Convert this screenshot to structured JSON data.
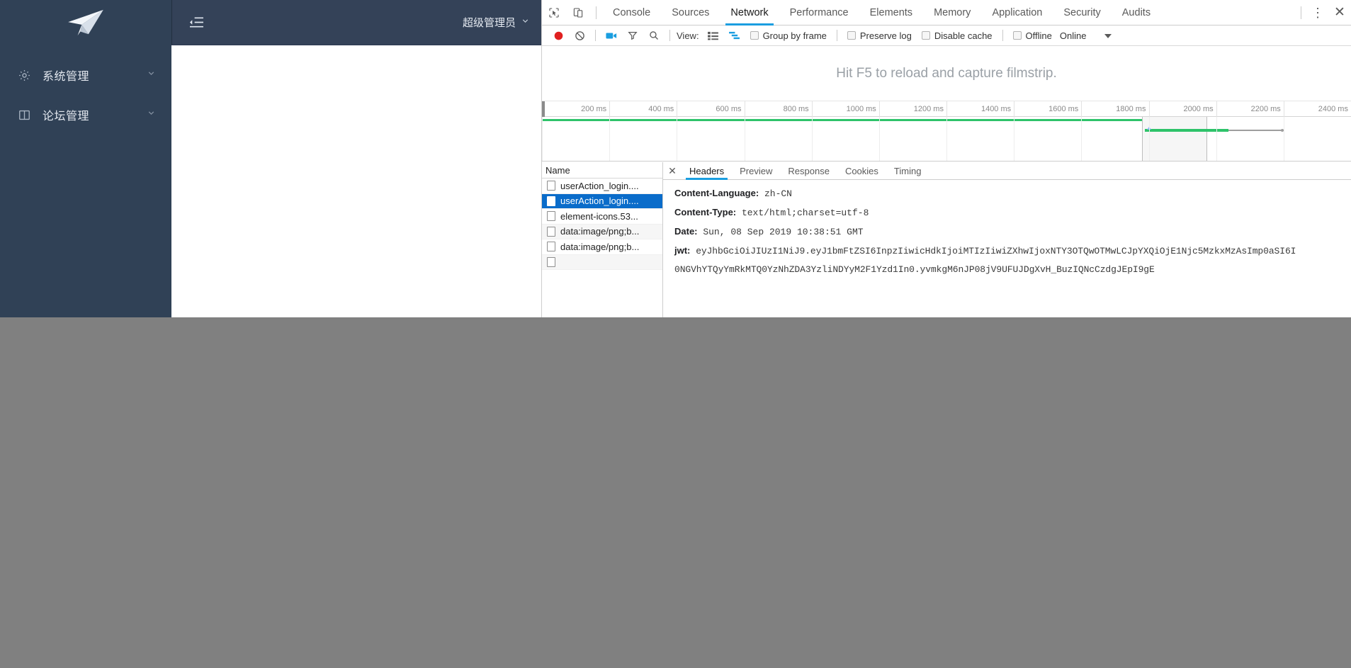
{
  "app": {
    "logo_icon": "paper-plane-icon",
    "sidebar": {
      "items": [
        {
          "icon": "gear-icon",
          "label": "系统管理",
          "arrow_icon": "chevron-down-icon"
        },
        {
          "icon": "book-icon",
          "label": "论坛管理",
          "arrow_icon": "chevron-down-icon"
        }
      ]
    },
    "navbar": {
      "collapse_icon": "hamburger-collapse-icon",
      "user_name": "超级管理员",
      "user_arrow_icon": "chevron-down-icon"
    }
  },
  "devtools": {
    "toolbar_icons": {
      "inspect": "inspect-element-icon",
      "device": "device-toolbar-icon",
      "more": "more-vertical-icon",
      "close": "close-icon"
    },
    "tabs": [
      {
        "label": "Console",
        "active": false
      },
      {
        "label": "Sources",
        "active": false
      },
      {
        "label": "Network",
        "active": true
      },
      {
        "label": "Performance",
        "active": false
      },
      {
        "label": "Elements",
        "active": false
      },
      {
        "label": "Memory",
        "active": false
      },
      {
        "label": "Application",
        "active": false
      },
      {
        "label": "Security",
        "active": false
      },
      {
        "label": "Audits",
        "active": false
      }
    ],
    "network_toolbar": {
      "record_icon": "record-circle-icon",
      "clear_icon": "clear-no-entry-icon",
      "filmstrip_icon": "camera-icon",
      "filter_icon": "funnel-filter-icon",
      "search_icon": "search-icon",
      "view_label": "View:",
      "view_list_icon": "list-view-icon",
      "view_waterfall_icon": "waterfall-view-icon",
      "group_by_frame": "Group by frame",
      "preserve_log": "Preserve log",
      "disable_cache": "Disable cache",
      "offline": "Offline",
      "throttling": "Online",
      "throttling_arrow_icon": "caret-down-icon"
    },
    "filmstrip": {
      "message": "Hit F5 to reload and capture filmstrip."
    },
    "overview": {
      "ticks": [
        "200 ms",
        "400 ms",
        "600 ms",
        "800 ms",
        "1000 ms",
        "1200 ms",
        "1400 ms",
        "1600 ms",
        "1800 ms",
        "2000 ms",
        "2200 ms",
        "2400 ms"
      ]
    },
    "request_list": {
      "column_header": "Name",
      "rows": [
        {
          "name": "userAction_login....",
          "icon": "document-icon",
          "selected": false
        },
        {
          "name": "userAction_login....",
          "icon": "document-icon",
          "selected": true
        },
        {
          "name": "element-icons.53...",
          "icon": "document-icon",
          "selected": false
        },
        {
          "name": "data:image/png;b...",
          "icon": "document-icon",
          "selected": false
        },
        {
          "name": "data:image/png;b...",
          "icon": "document-icon",
          "selected": false
        }
      ]
    },
    "detail": {
      "close_icon": "close-icon",
      "tabs": [
        {
          "label": "Headers",
          "active": true
        },
        {
          "label": "Preview",
          "active": false
        },
        {
          "label": "Response",
          "active": false
        },
        {
          "label": "Cookies",
          "active": false
        },
        {
          "label": "Timing",
          "active": false
        }
      ],
      "headers": [
        {
          "key": "Content-Language:",
          "value": "zh-CN"
        },
        {
          "key": "Content-Type:",
          "value": "text/html;charset=utf-8"
        },
        {
          "key": "Date:",
          "value": "Sun, 08 Sep 2019 10:38:51 GMT"
        }
      ],
      "jwt_key": "jwt:",
      "jwt_line1": "eyJhbGciOiJIUzI1NiJ9.eyJ1bmFtZSI6InpzIiwicHdkIjoiMTIzIiwiZXhwIjoxNTY3OTQwOTMwLCJpYXQiOjE1Njc5MzkxMzAsImp0aSI6I",
      "jwt_line2": "0NGVhYTQyYmRkMTQ0YzNhZDA3YzliNDYyM2F1Yzd1In0.yvmkgM6nJP08jV9UFUJDgXvH_BuzIQNcCzdgJEpI9gE"
    }
  },
  "colors": {
    "sidebar_bg": "#304156",
    "navbar_bg": "#344258",
    "accent_blue": "#1a9ee0",
    "selection_blue": "#0a6cca",
    "timeline_green": "#2ec36a",
    "record_red": "#e02020",
    "desktop_gray": "#808080"
  }
}
